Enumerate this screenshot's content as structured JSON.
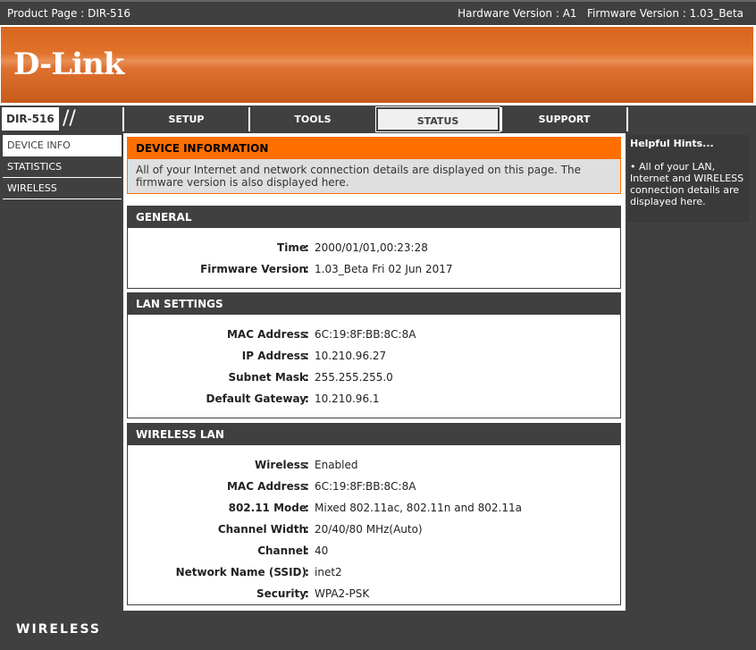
{
  "topbar": {
    "product": "Product Page : DIR-516",
    "versions": "Hardware Version : A1   Firmware Version : 1.03_Beta"
  },
  "brand": {
    "logo": "D-Link",
    "model": "DIR-516",
    "footer": "WIRELESS"
  },
  "tabs": [
    {
      "label": "SETUP"
    },
    {
      "label": "TOOLS"
    },
    {
      "label": "STATUS"
    },
    {
      "label": "SUPPORT"
    }
  ],
  "sidebar": [
    {
      "label": "DEVICE INFO"
    },
    {
      "label": "STATISTICS"
    },
    {
      "label": "WIRELESS"
    }
  ],
  "intro": {
    "title": "DEVICE INFORMATION",
    "text": "All of your Internet and network connection details are displayed on this page. The firmware version is also displayed here."
  },
  "hints": {
    "title": "Helpful Hints...",
    "text": "• All of your LAN, Internet and WIRELESS connection details are displayed here."
  },
  "general": {
    "title": "GENERAL",
    "rows": [
      {
        "k": "Time",
        "v": "2000/01/01,00:23:28"
      },
      {
        "k": "Firmware Version",
        "v": "1.03_Beta Fri 02 Jun 2017"
      }
    ]
  },
  "lan": {
    "title": "LAN SETTINGS",
    "rows": [
      {
        "k": "MAC Address",
        "v": "6C:19:8F:BB:8C:8A"
      },
      {
        "k": "IP Address",
        "v": "10.210.96.27"
      },
      {
        "k": "Subnet Mask",
        "v": "255.255.255.0"
      },
      {
        "k": "Default Gateway",
        "v": "10.210.96.1"
      }
    ]
  },
  "wlan": {
    "title": "WIRELESS LAN",
    "rows": [
      {
        "k": "Wireless",
        "v": "Enabled"
      },
      {
        "k": "MAC Address",
        "v": "6C:19:8F:BB:8C:8A"
      },
      {
        "k": "802.11 Mode",
        "v": "Mixed 802.11ac, 802.11n and 802.11a"
      },
      {
        "k": "Channel Width",
        "v": "20/40/80 MHz(Auto)"
      },
      {
        "k": "Channel",
        "v": "40"
      },
      {
        "k": "Network Name (SSID)",
        "v": "inet2"
      },
      {
        "k": "Security",
        "v": "WPA2-PSK"
      }
    ]
  },
  "colon": ":"
}
